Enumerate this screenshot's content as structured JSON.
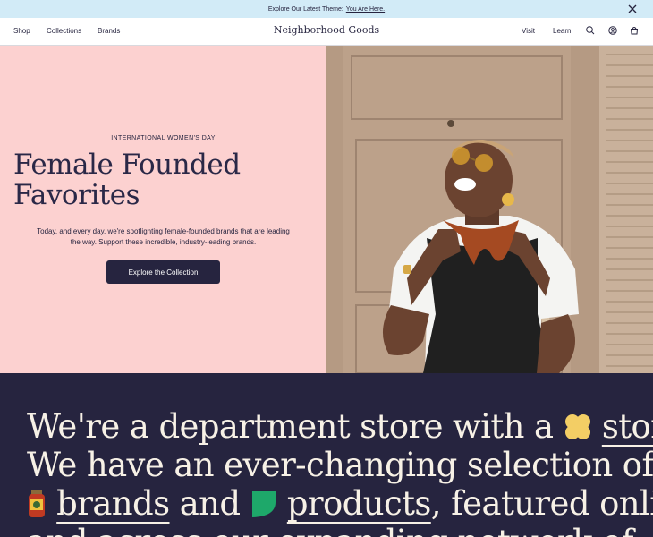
{
  "announcement": {
    "text": "Explore Our Latest Theme:",
    "link_label": "You Are Here.",
    "close_icon": "close-icon"
  },
  "nav": {
    "left": [
      "Shop",
      "Collections",
      "Brands"
    ],
    "logo": "Neighborhood Goods",
    "right": [
      "Visit",
      "Learn"
    ],
    "icons": [
      "search-icon",
      "account-icon",
      "bag-icon"
    ]
  },
  "hero": {
    "eyebrow": "INTERNATIONAL WOMEN'S DAY",
    "headline_line1": "Female Founded",
    "headline_line2": "Favorites",
    "subtext": "Today, and every day, we're spotlighting female-founded brands that are leading the way. Support these incredible, industry-leading brands.",
    "cta_label": "Explore the Collection",
    "background_color": "#fcd1d0"
  },
  "story": {
    "line1_a": "We're a department store with a",
    "line1_link": "story",
    "line1_end": ".",
    "line2": "We have an ever-changing selection of",
    "line3_link1": "brands",
    "line3_mid": "and",
    "line3_link2": "products",
    "line3_end": ", featured online",
    "line4": "and across our expanding network of",
    "icons": [
      "flower-icon",
      "jar-icon",
      "leaf-icon"
    ],
    "background_color": "#26243f"
  }
}
